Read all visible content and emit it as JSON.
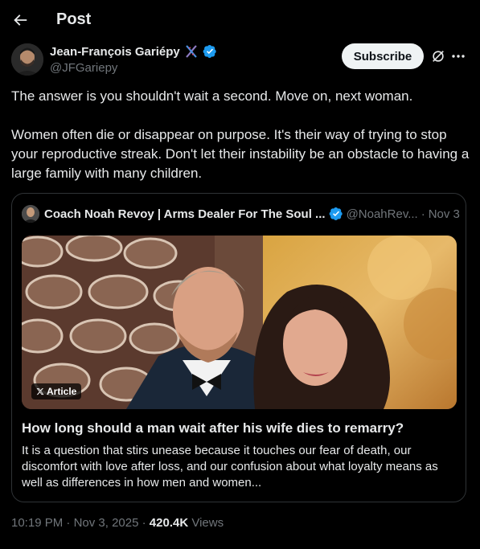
{
  "header": {
    "title": "Post"
  },
  "author": {
    "name": "Jean-François Gariépy",
    "handle": "@JFGariepy",
    "subscribe_label": "Subscribe"
  },
  "post": {
    "paragraphs": [
      "The answer is you shouldn't wait a second. Move on, next woman.",
      "Women often die or disappear on purpose. It's their way of trying to stop your reproductive streak. Don't let their instability be an obstacle to having a large family with many children."
    ]
  },
  "quoted": {
    "name": "Coach Noah Revoy | Arms Dealer For The Soul ...",
    "handle": "@NoahRev...",
    "separator": "·",
    "date": "Nov 3",
    "badge_label": "Article",
    "title": "How long should a man wait after his wife dies to remarry?",
    "description": "It is a question that stirs unease because it touches our fear of death, our discomfort with love after loss, and our confusion about what loyalty means as well as differences in how men and women..."
  },
  "meta": {
    "time": "10:19 PM",
    "sep1": "·",
    "date": "Nov 3, 2025",
    "sep2": "·",
    "views_count": "420.4K",
    "views_label": "Views"
  },
  "icons": {
    "back": "back-arrow-icon",
    "verified": "verified-badge-icon",
    "dna": "dna-emoji-icon",
    "grok": "grok-icon",
    "more": "more-icon",
    "x_logo": "x-logo-icon"
  },
  "colors": {
    "verified": "#1d9bf0",
    "background": "#000000",
    "muted": "#71767b"
  }
}
